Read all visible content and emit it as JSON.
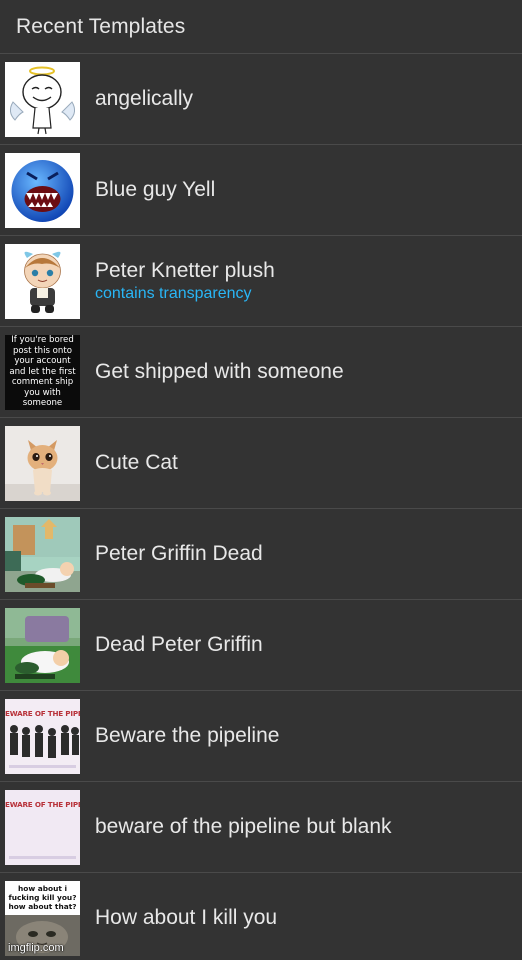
{
  "header": {
    "title": "Recent Templates"
  },
  "templates": [
    {
      "name": "angelically",
      "icon": "angel-meme-face-thumbnail"
    },
    {
      "name": "Blue guy Yell",
      "icon": "blue-yelling-face-thumbnail"
    },
    {
      "name": "Peter Knetter plush",
      "subtitle": "contains transparency",
      "icon": "plush-doll-thumbnail"
    },
    {
      "name": "Get shipped with someone",
      "icon": "text-post-thumbnail",
      "thumb_text": "If you're bored post this onto your account and let the first comment ship you with someone"
    },
    {
      "name": "Cute Cat",
      "icon": "kitten-thumbnail"
    },
    {
      "name": "Peter Griffin Dead",
      "icon": "cartoon-scene-thumbnail"
    },
    {
      "name": "Dead Peter Griffin",
      "icon": "cartoon-scene-thumbnail"
    },
    {
      "name": "Beware the pipeline",
      "icon": "pipeline-banner-thumbnail",
      "thumb_text": "EWARE OF THE PIPELINE"
    },
    {
      "name": "beware of the pipeline but blank",
      "icon": "pipeline-blank-thumbnail",
      "thumb_text": "EWARE OF THE PIPELINE"
    },
    {
      "name": "How about I kill you",
      "icon": "cat-meme-thumbnail",
      "thumb_text": "how about i fucking kill you? how about that?",
      "watermark": "imgflip.com"
    }
  ],
  "colors": {
    "background": "#333333",
    "divider": "#4a4a4a",
    "text": "#e8e8e8",
    "accent": "#29b6f6"
  }
}
